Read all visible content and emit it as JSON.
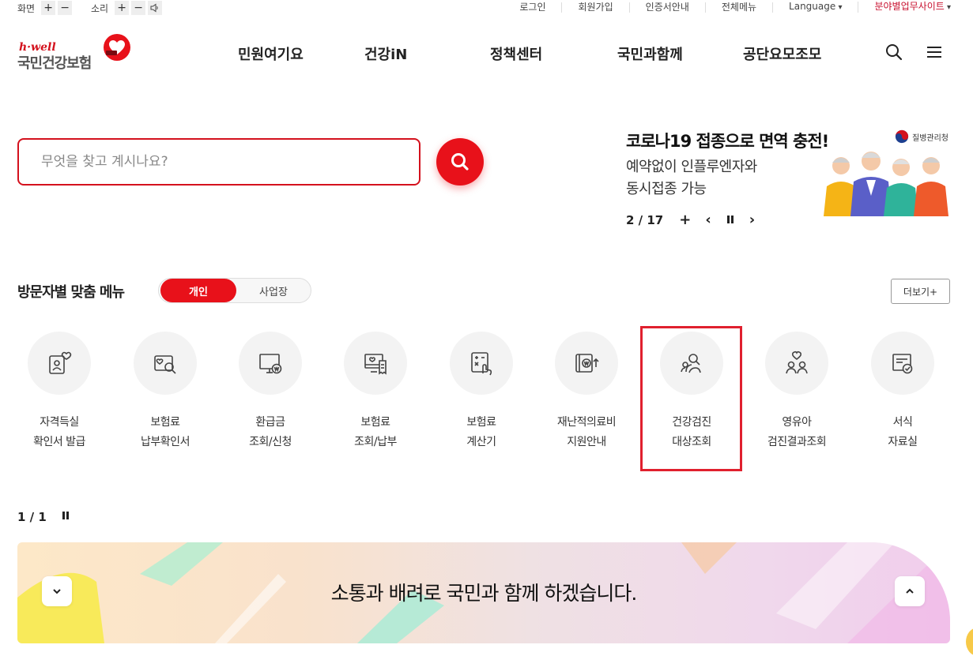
{
  "utility": {
    "screen_label": "화면",
    "sound_label": "소리",
    "plus": "+",
    "minus": "−",
    "links": [
      "로그인",
      "회원가입",
      "인증서안내",
      "전체메뉴"
    ],
    "language": "Language",
    "business_sites": "분야별업무사이트"
  },
  "logo": {
    "tagline": "h·well",
    "name": "국민건강보험"
  },
  "gnb": [
    "민원여기요",
    "건강iN",
    "정책센터",
    "국민과함께",
    "공단요모조모"
  ],
  "search": {
    "placeholder": "무엇을 찾고 계시나요?"
  },
  "banner": {
    "title": "코로나19 접종으로 면역 충전!",
    "subtitle_lines": [
      "예약없이 인플루엔자와",
      "동시접종 가능"
    ],
    "agency": "질병관리청",
    "page": "2 / 17",
    "add": "+",
    "prev": "‹",
    "next": "›"
  },
  "visitor_menu": {
    "title": "방문자별 맞춤 메뉴",
    "tabs": [
      "개인",
      "사업장"
    ],
    "more": "더보기+",
    "items": [
      {
        "line1": "자격득실",
        "line2": "확인서 발급",
        "icon": "id-card-icon"
      },
      {
        "line1": "보험료",
        "line2": "납부확인서",
        "icon": "document-search-icon"
      },
      {
        "line1": "환급금",
        "line2": "조회/신청",
        "icon": "monitor-won-icon"
      },
      {
        "line1": "보험료",
        "line2": "조회/납부",
        "icon": "monitor-receipt-icon"
      },
      {
        "line1": "보험료",
        "line2": "계산기",
        "icon": "calculator-touch-icon"
      },
      {
        "line1": "재난적의료비",
        "line2": "지원안내",
        "icon": "wallet-won-icon"
      },
      {
        "line1": "건강검진",
        "line2": "대상조회",
        "icon": "people-search-icon"
      },
      {
        "line1": "영유아",
        "line2": "검진결과조회",
        "icon": "family-heart-icon"
      },
      {
        "line1": "서식",
        "line2": "자료실",
        "icon": "form-check-icon"
      }
    ],
    "pager": "1 / 1"
  },
  "bottom_banner": {
    "text": "소통과 배려로 국민과 함께 하겠습니다."
  },
  "colors": {
    "brand_red": "#e8111a",
    "highlight": "#e0202e"
  }
}
